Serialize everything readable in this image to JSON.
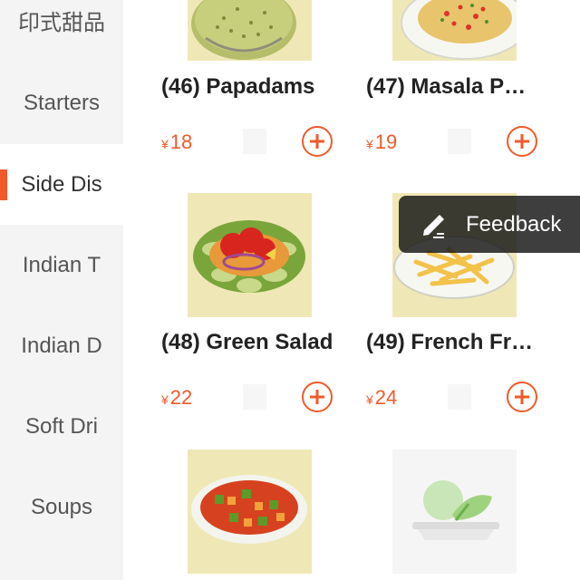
{
  "sidebar": {
    "items": [
      {
        "label": "印式甜品",
        "active": false
      },
      {
        "label": "Starters",
        "active": false
      },
      {
        "label": "Side Dis",
        "active": true
      },
      {
        "label": "Indian T",
        "active": false
      },
      {
        "label": "Indian D",
        "active": false
      },
      {
        "label": "Soft Dri",
        "active": false
      },
      {
        "label": "Soups",
        "active": false
      }
    ]
  },
  "products": [
    {
      "name": "(46) Papadams",
      "currency": "¥",
      "price": "18",
      "image": "papadams"
    },
    {
      "name": "(47) Masala P…",
      "currency": "¥",
      "price": "19",
      "image": "masala-papad"
    },
    {
      "name": "(48) Green Salad",
      "currency": "¥",
      "price": "22",
      "image": "green-salad"
    },
    {
      "name": "(49) French Fr…",
      "currency": "¥",
      "price": "24",
      "image": "french-fries"
    },
    {
      "name": "",
      "currency": "",
      "price": "",
      "image": "mixed-salad"
    },
    {
      "name": "",
      "currency": "",
      "price": "",
      "image": "placeholder-salad"
    }
  ],
  "feedback": {
    "label": "Feedback",
    "icon": "edit-icon"
  },
  "colors": {
    "accent": "#f05a2a",
    "sidebar_bg": "#f4f4f4",
    "thumb_bg": "#efe8b6"
  }
}
